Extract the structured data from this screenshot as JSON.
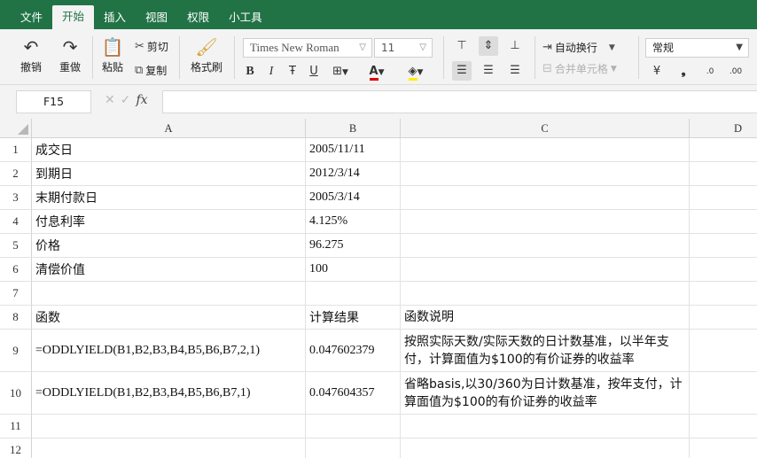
{
  "menu": [
    "文件",
    "开始",
    "插入",
    "视图",
    "权限",
    "小工具"
  ],
  "active_menu_index": 1,
  "ribbon": {
    "undo": "撤销",
    "redo": "重做",
    "paste": "粘贴",
    "cut": "剪切",
    "copy": "复制",
    "format_painter": "格式刷",
    "font_name": "Times New Roman",
    "font_size": "11",
    "bold": "B",
    "italic": "I",
    "strike": "Ŧ",
    "underline": "U",
    "wrap_text": "自动换行",
    "merge_cells": "合并单元格",
    "number_format": "常规",
    "currency": "¥",
    "percent_comma": "❟",
    "inc_decimal": ".0",
    "dec_decimal": ".00",
    "font_color_hex": "#e00000",
    "fill_color_hex": "#ffee00"
  },
  "formula_bar": {
    "name_box": "F15",
    "fx": "fx",
    "formula": ""
  },
  "columns": [
    "A",
    "B",
    "C",
    "D"
  ],
  "rows": [
    {
      "n": "1",
      "a": "成交日",
      "b": "2005/11/11",
      "c": ""
    },
    {
      "n": "2",
      "a": "到期日",
      "b": "2012/3/14",
      "c": ""
    },
    {
      "n": "3",
      "a": "末期付款日",
      "b": "2005/3/14",
      "c": ""
    },
    {
      "n": "4",
      "a": "付息利率",
      "b": "4.125%",
      "c": ""
    },
    {
      "n": "5",
      "a": "价格",
      "b": "96.275",
      "c": ""
    },
    {
      "n": "6",
      "a": "清偿价值",
      "b": "100",
      "c": ""
    },
    {
      "n": "7",
      "a": "",
      "b": "",
      "c": ""
    },
    {
      "n": "8",
      "a": "函数",
      "b": "计算结果",
      "c": "函数说明"
    },
    {
      "n": "9",
      "a": "=ODDLYIELD(B1,B2,B3,B4,B5,B6,B7,2,1)",
      "b": "0.047602379",
      "c": "按照实际天数/实际天数的日计数基准，以半年支付，计算面值为$100的有价证券的收益率"
    },
    {
      "n": "10",
      "a": "=ODDLYIELD(B1,B2,B3,B4,B5,B6,B7,1)",
      "b": "0.047604357",
      "c": "省略basis,以30/360为日计数基准，按年支付，计算面值为$100的有价证券的收益率"
    },
    {
      "n": "11",
      "a": "",
      "b": "",
      "c": ""
    },
    {
      "n": "12",
      "a": "",
      "b": "",
      "c": ""
    }
  ]
}
